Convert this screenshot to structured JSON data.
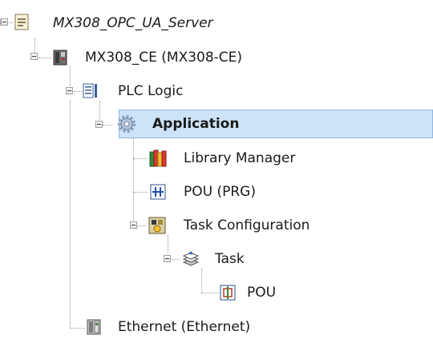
{
  "tree": {
    "nodes": [
      {
        "label": "MX308_OPC_UA_Server",
        "icon": "project-icon",
        "expanded": true
      },
      {
        "label": "MX308_CE (MX308-CE)",
        "icon": "device-icon",
        "expanded": true
      },
      {
        "label": "PLC Logic",
        "icon": "plc-logic-icon",
        "expanded": true
      },
      {
        "label": "Application",
        "icon": "application-gear-icon",
        "expanded": true,
        "selected": true
      },
      {
        "label": "Library Manager",
        "icon": "library-books-icon"
      },
      {
        "label": "POU (PRG)",
        "icon": "pou-prg-icon"
      },
      {
        "label": "Task Configuration",
        "icon": "task-configuration-icon",
        "expanded": true
      },
      {
        "label": "Task",
        "icon": "task-stack-icon",
        "expanded": true
      },
      {
        "label": "POU",
        "icon": "pou-call-icon"
      },
      {
        "label": "Ethernet (Ethernet)",
        "icon": "ethernet-device-icon"
      }
    ]
  },
  "colors": {
    "selection": "#cde3f7",
    "selection_border": "#8fb8e0"
  }
}
